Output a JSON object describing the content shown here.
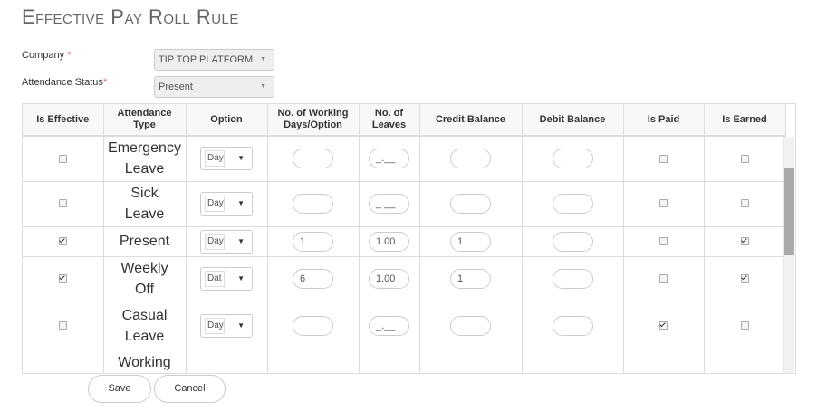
{
  "page": {
    "title": "Effective Pay Roll Rule"
  },
  "form": {
    "company_label": "Company",
    "company_required": "*",
    "company_value": "TIP TOP PLATFORM",
    "attendance_label": "Attendance Status",
    "attendance_required": "*",
    "attendance_value": "Present"
  },
  "table": {
    "headers": {
      "is_effective": "Is Effective",
      "attendance_type": "Attendance Type",
      "option": "Option",
      "working_days": "No. of Working Days/Option",
      "leaves": "No. of Leaves",
      "credit": "Credit Balance",
      "debit": "Debit Balance",
      "is_paid": "Is Paid",
      "is_earned": "Is Earned"
    },
    "rows": [
      {
        "effective": false,
        "type_line1": "Emergency",
        "type_line2": "Leave",
        "option": "Day",
        "working_days": "",
        "leaves": "_.__",
        "credit": "",
        "debit": "",
        "paid": false,
        "earned": false
      },
      {
        "effective": false,
        "type_line1": "Sick",
        "type_line2": "Leave",
        "option": "Day",
        "working_days": "",
        "leaves": "_.__",
        "credit": "",
        "debit": "",
        "paid": false,
        "earned": false
      },
      {
        "effective": true,
        "type_line1": "Present",
        "type_line2": "",
        "option": "Day",
        "working_days": "1",
        "leaves": "1.00",
        "credit": "1",
        "debit": "",
        "paid": false,
        "earned": true
      },
      {
        "effective": true,
        "type_line1": "Weekly",
        "type_line2": "Off",
        "option": "Dat",
        "working_days": "6",
        "leaves": "1.00",
        "credit": "1",
        "debit": "",
        "paid": false,
        "earned": true
      },
      {
        "effective": false,
        "type_line1": "Casual",
        "type_line2": "Leave",
        "option": "Day",
        "working_days": "",
        "leaves": "_.__",
        "credit": "",
        "debit": "",
        "paid": true,
        "earned": false
      },
      {
        "effective": false,
        "type_line1": "Working",
        "type_line2": "",
        "option": "",
        "working_days": "",
        "leaves": "",
        "credit": "",
        "debit": "",
        "paid": false,
        "earned": false
      }
    ]
  },
  "icons": {
    "dropdown": "caret-down-icon",
    "checkbox": "checkbox-icon"
  },
  "actions": {
    "save_label": "Save",
    "cancel_label": "Cancel"
  }
}
